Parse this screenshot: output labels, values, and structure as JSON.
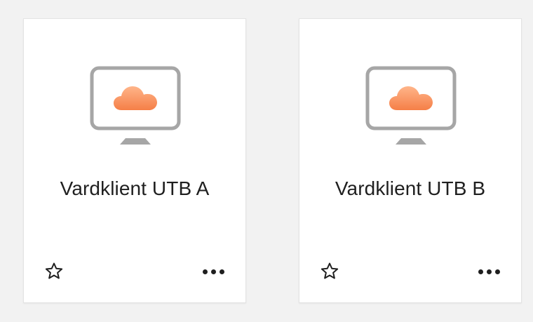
{
  "cards": [
    {
      "title": "Vardklient UTB A",
      "icon": "cloud-desktop-icon",
      "favorite_icon": "star-outline-icon",
      "more_icon": "ellipsis-icon"
    },
    {
      "title": "Vardklient UTB B",
      "icon": "cloud-desktop-icon",
      "favorite_icon": "star-outline-icon",
      "more_icon": "ellipsis-icon"
    }
  ],
  "colors": {
    "background": "#f2f2f2",
    "card": "#ffffff",
    "monitor": "#a6a6a6",
    "cloud_start": "#ffb07a",
    "cloud_end": "#f6864f",
    "text": "#1f1f1f"
  }
}
